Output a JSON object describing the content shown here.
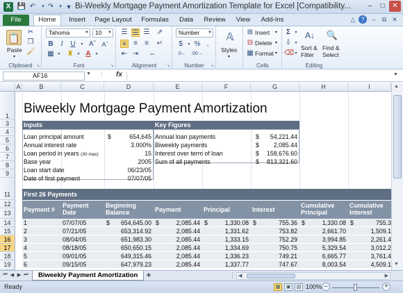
{
  "window": {
    "title": "Bi-Weekly Mortgage Payment Amortization Template for Excel  [Compatibility...",
    "app_icon": "excel-icon",
    "controls": [
      "minimize",
      "maximize",
      "close"
    ]
  },
  "tabs": {
    "file": "File",
    "items": [
      "Home",
      "Insert",
      "Page Layout",
      "Formulas",
      "Data",
      "Review",
      "View",
      "Add-Ins"
    ],
    "active": "Home"
  },
  "ribbon": {
    "clipboard": {
      "paste": "Paste",
      "label": "Clipboard"
    },
    "font": {
      "name": "Tahoma",
      "size": "10",
      "label": "Font",
      "bold": "B",
      "italic": "I",
      "underline": "U"
    },
    "alignment": {
      "label": "Alignment"
    },
    "number": {
      "format": "Number",
      "label": "Number",
      "currency": "$",
      "percent": "%",
      "comma": ","
    },
    "styles": {
      "label": "Styles"
    },
    "cells": {
      "insert": "Insert",
      "delete": "Delete",
      "format": "Format",
      "label": "Cells"
    },
    "editing": {
      "sort_filter": "Sort &",
      "sort_filter2": "Filter",
      "find_select": "Find &",
      "find_select2": "Select",
      "label": "Editing"
    }
  },
  "formula_bar": {
    "name_box": "AF16",
    "fx": "fx",
    "formula": ""
  },
  "columns": [
    "A",
    "B",
    "C",
    "D",
    "E",
    "F",
    "G",
    "H",
    "I"
  ],
  "rows": [
    "1",
    "3",
    "4",
    "5",
    "6",
    "7",
    "8",
    "9",
    "11",
    "12",
    "13",
    "14",
    "15",
    "16",
    "17",
    "18",
    "19"
  ],
  "selected_rows": [
    "16",
    "17"
  ],
  "sheet": {
    "title": "Biweekly Mortgage Payment Amortization",
    "inputs": {
      "header": "Inputs",
      "rows": [
        {
          "label": "Loan principal amount",
          "unit": "$",
          "value": "654,645"
        },
        {
          "label": "Annual interest rate",
          "unit": "",
          "value": "3.000%"
        },
        {
          "label": "Loan period in years",
          "note": "(30 max)",
          "unit": "",
          "value": "15"
        },
        {
          "label": "Base year",
          "unit": "",
          "value": "2005"
        },
        {
          "label": "Loan start date",
          "unit": "",
          "value": "06/23/05"
        },
        {
          "label": "Date of first payment",
          "unit": "",
          "value": "07/07/05"
        }
      ]
    },
    "key_figures": {
      "header": "Key Figures",
      "rows": [
        {
          "label": "Annual loan payments",
          "unit": "$",
          "value": "54,221.44"
        },
        {
          "label": "Biweekly payments",
          "unit": "$",
          "value": "2,085.44"
        },
        {
          "label": "Interest over term of loan",
          "unit": "$",
          "value": "158,676.60"
        },
        {
          "label": "Sum of all payments",
          "unit": "$",
          "value": "813,321.60"
        }
      ]
    },
    "payments": {
      "header": "First 26 Payments",
      "columns": [
        {
          "line1": "Payment #",
          "line2": ""
        },
        {
          "line1": "Payment",
          "line2": "Date"
        },
        {
          "line1": "Beginning",
          "line2": "Balance"
        },
        {
          "line1": "Payment",
          "line2": ""
        },
        {
          "line1": "Principal",
          "line2": ""
        },
        {
          "line1": "Interest",
          "line2": ""
        },
        {
          "line1": "Cumulative",
          "line2": "Principal"
        },
        {
          "line1": "Cumulative",
          "line2": "Interest"
        }
      ],
      "rows": [
        {
          "n": "1",
          "date": "07/07/05",
          "bal_unit": "$",
          "balance": "654,645.00",
          "pay_unit": "$",
          "payment": "2,085.44",
          "pr_unit": "$",
          "principal": "1,330.08",
          "in_unit": "$",
          "interest": "755.36",
          "cp_unit": "$",
          "cum_principal": "1,330.08",
          "ci_unit": "$",
          "cum_interest": "755.3"
        },
        {
          "n": "2",
          "date": "07/21/05",
          "bal_unit": "",
          "balance": "653,314.92",
          "pay_unit": "",
          "payment": "2,085.44",
          "pr_unit": "",
          "principal": "1,331.62",
          "in_unit": "",
          "interest": "753.82",
          "cp_unit": "",
          "cum_principal": "2,661.70",
          "ci_unit": "",
          "cum_interest": "1,509.1"
        },
        {
          "n": "3",
          "date": "08/04/05",
          "bal_unit": "",
          "balance": "651,983.30",
          "pay_unit": "",
          "payment": "2,085.44",
          "pr_unit": "",
          "principal": "1,333.15",
          "in_unit": "",
          "interest": "752.29",
          "cp_unit": "",
          "cum_principal": "3,994.85",
          "ci_unit": "",
          "cum_interest": "2,261.4"
        },
        {
          "n": "4",
          "date": "08/18/05",
          "bal_unit": "",
          "balance": "650,650.15",
          "pay_unit": "",
          "payment": "2,085.44",
          "pr_unit": "",
          "principal": "1,334.69",
          "in_unit": "",
          "interest": "750.75",
          "cp_unit": "",
          "cum_principal": "5,329.54",
          "ci_unit": "",
          "cum_interest": "3,012.2"
        },
        {
          "n": "5",
          "date": "09/01/05",
          "bal_unit": "",
          "balance": "649,315.46",
          "pay_unit": "",
          "payment": "2,085.44",
          "pr_unit": "",
          "principal": "1,336.23",
          "in_unit": "",
          "interest": "749.21",
          "cp_unit": "",
          "cum_principal": "6,665.77",
          "ci_unit": "",
          "cum_interest": "3,761.4"
        },
        {
          "n": "6",
          "date": "09/15/05",
          "bal_unit": "",
          "balance": "647,979.23",
          "pay_unit": "",
          "payment": "2,085.44",
          "pr_unit": "",
          "principal": "1,337.77",
          "in_unit": "",
          "interest": "747.67",
          "cp_unit": "",
          "cum_principal": "8,003.54",
          "ci_unit": "",
          "cum_interest": "4,509.1"
        }
      ]
    }
  },
  "sheet_tabs": {
    "active": "Biweekly Payment Amortization"
  },
  "status": {
    "text": "Ready",
    "zoom": "100%"
  },
  "colors": {
    "accent": "#2a7a3e",
    "section_header": "#5f6f83",
    "table_header": "#8393a6",
    "selected_row": "#f8d685"
  }
}
